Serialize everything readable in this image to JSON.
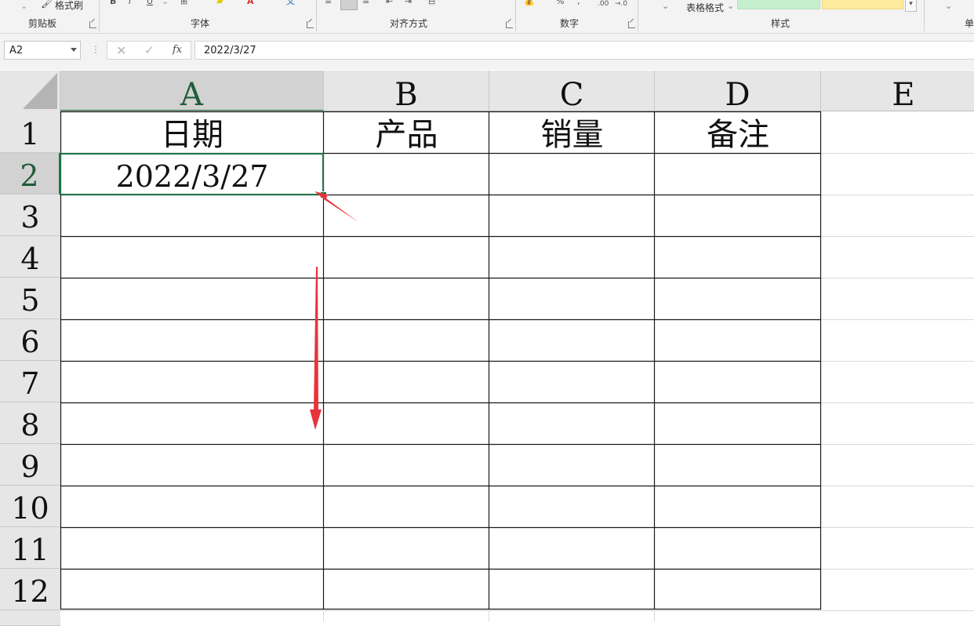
{
  "ribbon": {
    "format_painter_label": "格式刷",
    "table_format_label": "表格格式",
    "groups": {
      "clipboard": "剪贴板",
      "font": "字体",
      "alignment": "对齐方式",
      "number": "数字",
      "styles": "样式",
      "cells": "单"
    },
    "style_swatch_colors": [
      "#c6efce",
      "#ffeb9c"
    ]
  },
  "formula_bar": {
    "name_box": "A2",
    "fx_label": "fx",
    "formula_value": "2022/3/27"
  },
  "sheet": {
    "columns": [
      "A",
      "B",
      "C",
      "D",
      "E"
    ],
    "rows": [
      "1",
      "2",
      "3",
      "4",
      "5",
      "6",
      "7",
      "8",
      "9",
      "10",
      "11",
      "12"
    ],
    "headers": {
      "a1": "日期",
      "b1": "产品",
      "c1": "销量",
      "d1": "备注"
    },
    "a2": "2022/3/27",
    "selected_cell": "A2",
    "selection_color": "#217346",
    "annotation_color": "#e8333a"
  }
}
